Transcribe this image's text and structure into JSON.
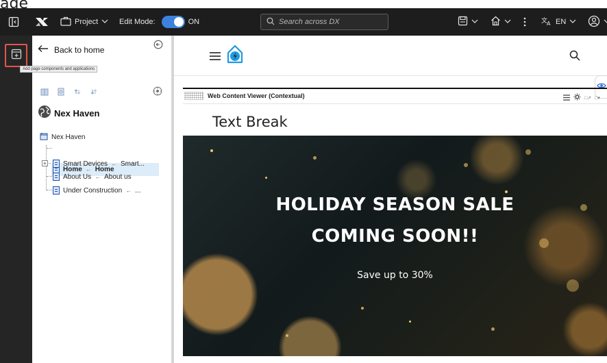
{
  "crop_text": "age",
  "topbar": {
    "project_label": "Project",
    "edit_mode_label": "Edit Mode:",
    "edit_mode_state": "ON",
    "search_placeholder": "Search across DX",
    "language": "EN"
  },
  "leftrail": {
    "tooltip": "Add page components and applications"
  },
  "sidepanel": {
    "back_label": "Back to home",
    "site_name": "Nex Haven",
    "tree": [
      {
        "label": "Nex Haven"
      },
      {
        "label": "Home",
        "alias": "Home"
      },
      {
        "label": "Smart Devices",
        "alias": "Smart..."
      },
      {
        "label": "About Us",
        "alias": "About us"
      },
      {
        "label": "Under Construction",
        "alias": "..."
      }
    ]
  },
  "main": {
    "portlet_title": "Web Content Viewer (Contextual)",
    "content_title": "Text Break",
    "hero": {
      "line1": "HOLIDAY SEASON SALE",
      "line2": "COMING SOON!!",
      "subtitle": "Save up to 30%"
    }
  },
  "colors": {
    "topbar_bg": "#1d1d1d",
    "accent": "#3c82dc",
    "highlight_border": "#e5534b",
    "selected_row_bg": "#dcecf8"
  }
}
